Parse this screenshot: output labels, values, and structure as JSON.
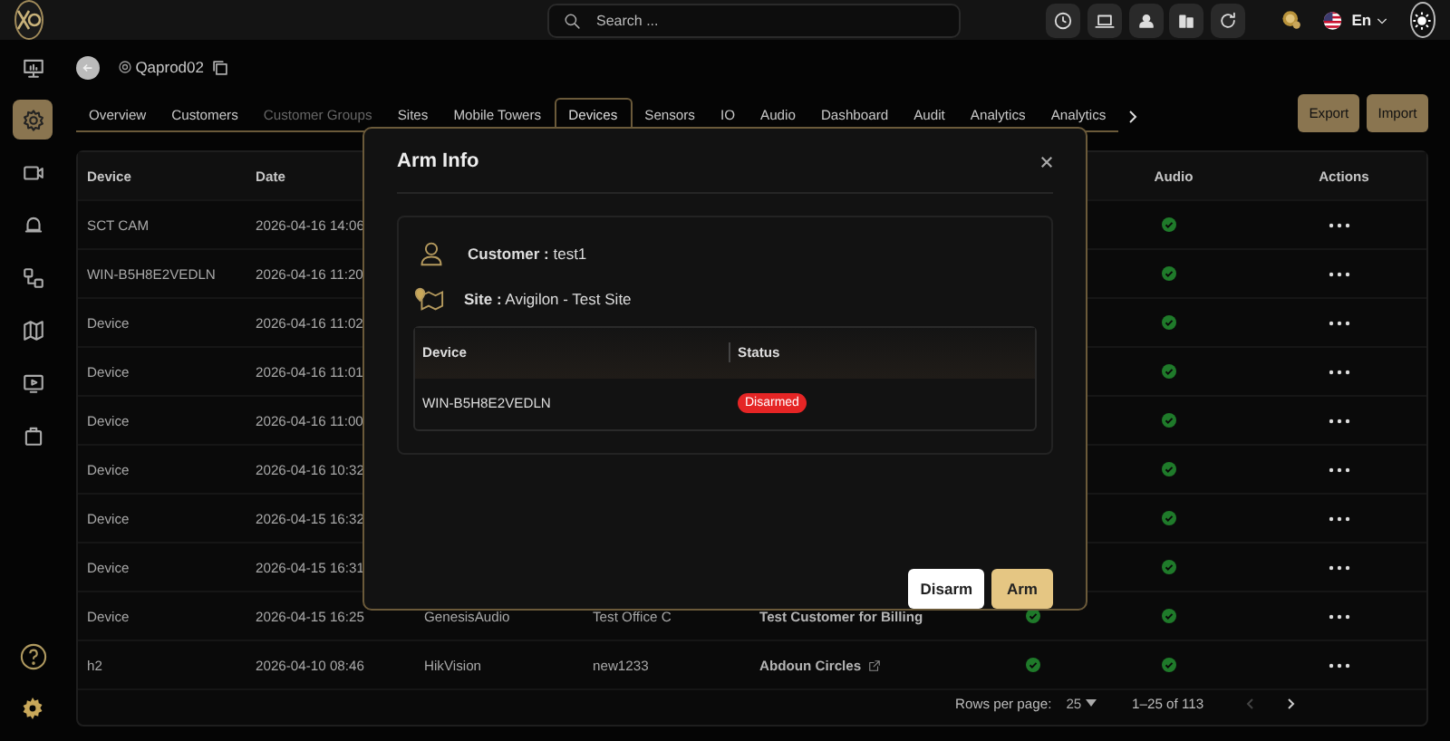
{
  "topbar": {
    "search": {
      "placeholder": "Search ..."
    },
    "language": "En"
  },
  "sidebar": {
    "items": [
      {
        "selected": false
      },
      {
        "selected": true
      },
      {
        "selected": false
      },
      {
        "selected": false
      },
      {
        "selected": false
      },
      {
        "selected": false
      },
      {
        "selected": false
      },
      {
        "selected": false
      }
    ]
  },
  "breadcrumb": {
    "title": "Qaprod02"
  },
  "tabs": [
    {
      "label": "Overview",
      "selected": false,
      "disabled": false
    },
    {
      "label": "Customers",
      "selected": false,
      "disabled": false
    },
    {
      "label": "Customer Groups",
      "selected": false,
      "disabled": true
    },
    {
      "label": "Sites",
      "selected": false,
      "disabled": false
    },
    {
      "label": "Mobile Towers",
      "selected": false,
      "disabled": false
    },
    {
      "label": "Devices",
      "selected": true,
      "disabled": false
    },
    {
      "label": "Sensors",
      "selected": false,
      "disabled": false
    },
    {
      "label": "IO",
      "selected": false,
      "disabled": false
    },
    {
      "label": "Audio",
      "selected": false,
      "disabled": false
    },
    {
      "label": "Dashboard",
      "selected": false,
      "disabled": false
    },
    {
      "label": "Audit",
      "selected": false,
      "disabled": false
    },
    {
      "label": "Analytics",
      "selected": false,
      "disabled": false
    },
    {
      "label": "Analytics",
      "selected": false,
      "disabled": false
    }
  ],
  "toolbar_buttons": [
    "Export",
    "Import"
  ],
  "table": {
    "columns": [
      "Device",
      "Date",
      "Audio",
      "Actions"
    ],
    "rows": [
      {
        "device": "SCT CAM",
        "date": "2026-04-16 14:06",
        "audio_ok": true
      },
      {
        "device": "WIN-B5H8E2VEDLN",
        "date": "2026-04-16 11:20",
        "audio_ok": true
      },
      {
        "device": "Device",
        "date": "2026-04-16 11:02",
        "audio_ok": true
      },
      {
        "device": "Device",
        "date": "2026-04-16 11:01",
        "audio_ok": true
      },
      {
        "device": "Device",
        "date": "2026-04-16 11:00",
        "audio_ok": true
      },
      {
        "device": "Device",
        "date": "2026-04-16 10:32",
        "audio_ok": true
      },
      {
        "device": "Device",
        "date": "2026-04-15 16:32",
        "audio_ok": true
      },
      {
        "device": "Device",
        "date": "2026-04-15 16:31",
        "audio_ok": true
      },
      {
        "device": "Device",
        "date": "2026-04-15 16:25",
        "column_3": "GenesisAudio",
        "column_4": "Test Office C",
        "column_5": "Test Customer for Billing",
        "column_5_link": false,
        "column_6_ok": true,
        "audio_ok": true
      },
      {
        "device": "h2",
        "date": "2026-04-10 08:46",
        "column_3": "HikVision",
        "column_4": "new1233",
        "column_5": "Abdoun Circles",
        "column_5_link": true,
        "column_6_ok": true,
        "audio_ok": true
      }
    ]
  },
  "pagination": {
    "rows_per_page_label": "Rows per page:",
    "rows_per_page": "25",
    "range": "1–25 of 113",
    "prev_disabled": true,
    "next_disabled": false
  },
  "modal": {
    "title": "Arm Info",
    "customer": "**Customer :** test1",
    "site": "**Site :** Avigilon - Test Site",
    "table": {
      "columns": [
        "Device",
        "Status"
      ],
      "rows": [
        {
          "device": "WIN-B5H8E2VEDLN",
          "status": "Disarmed",
          "armed": false
        }
      ]
    },
    "buttons": [
      {
        "label": "Disarm",
        "kind": "light"
      },
      {
        "label": "Arm",
        "kind": "primary"
      }
    ]
  }
}
